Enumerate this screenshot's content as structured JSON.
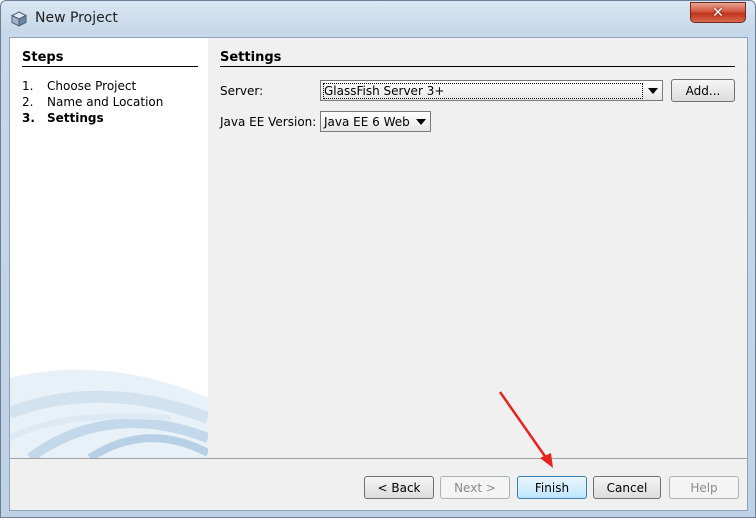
{
  "window": {
    "title": "New Project",
    "close_label": "✕"
  },
  "steps": {
    "heading": "Steps",
    "items": [
      {
        "num": "1.",
        "label": "Choose Project"
      },
      {
        "num": "2.",
        "label": "Name and Location"
      },
      {
        "num": "3.",
        "label": "Settings"
      }
    ]
  },
  "settings": {
    "heading": "Settings",
    "server_label": "Server:",
    "server_value": "GlassFish Server 3+",
    "add_label": "Add...",
    "javaee_label": "Java EE Version:",
    "javaee_value": "Java EE 6 Web"
  },
  "buttons": {
    "back": "< Back",
    "next": "Next >",
    "finish": "Finish",
    "cancel": "Cancel",
    "help": "Help"
  },
  "colors": {
    "annotation_arrow": "#e8231f",
    "close_button": "#c7402a"
  }
}
